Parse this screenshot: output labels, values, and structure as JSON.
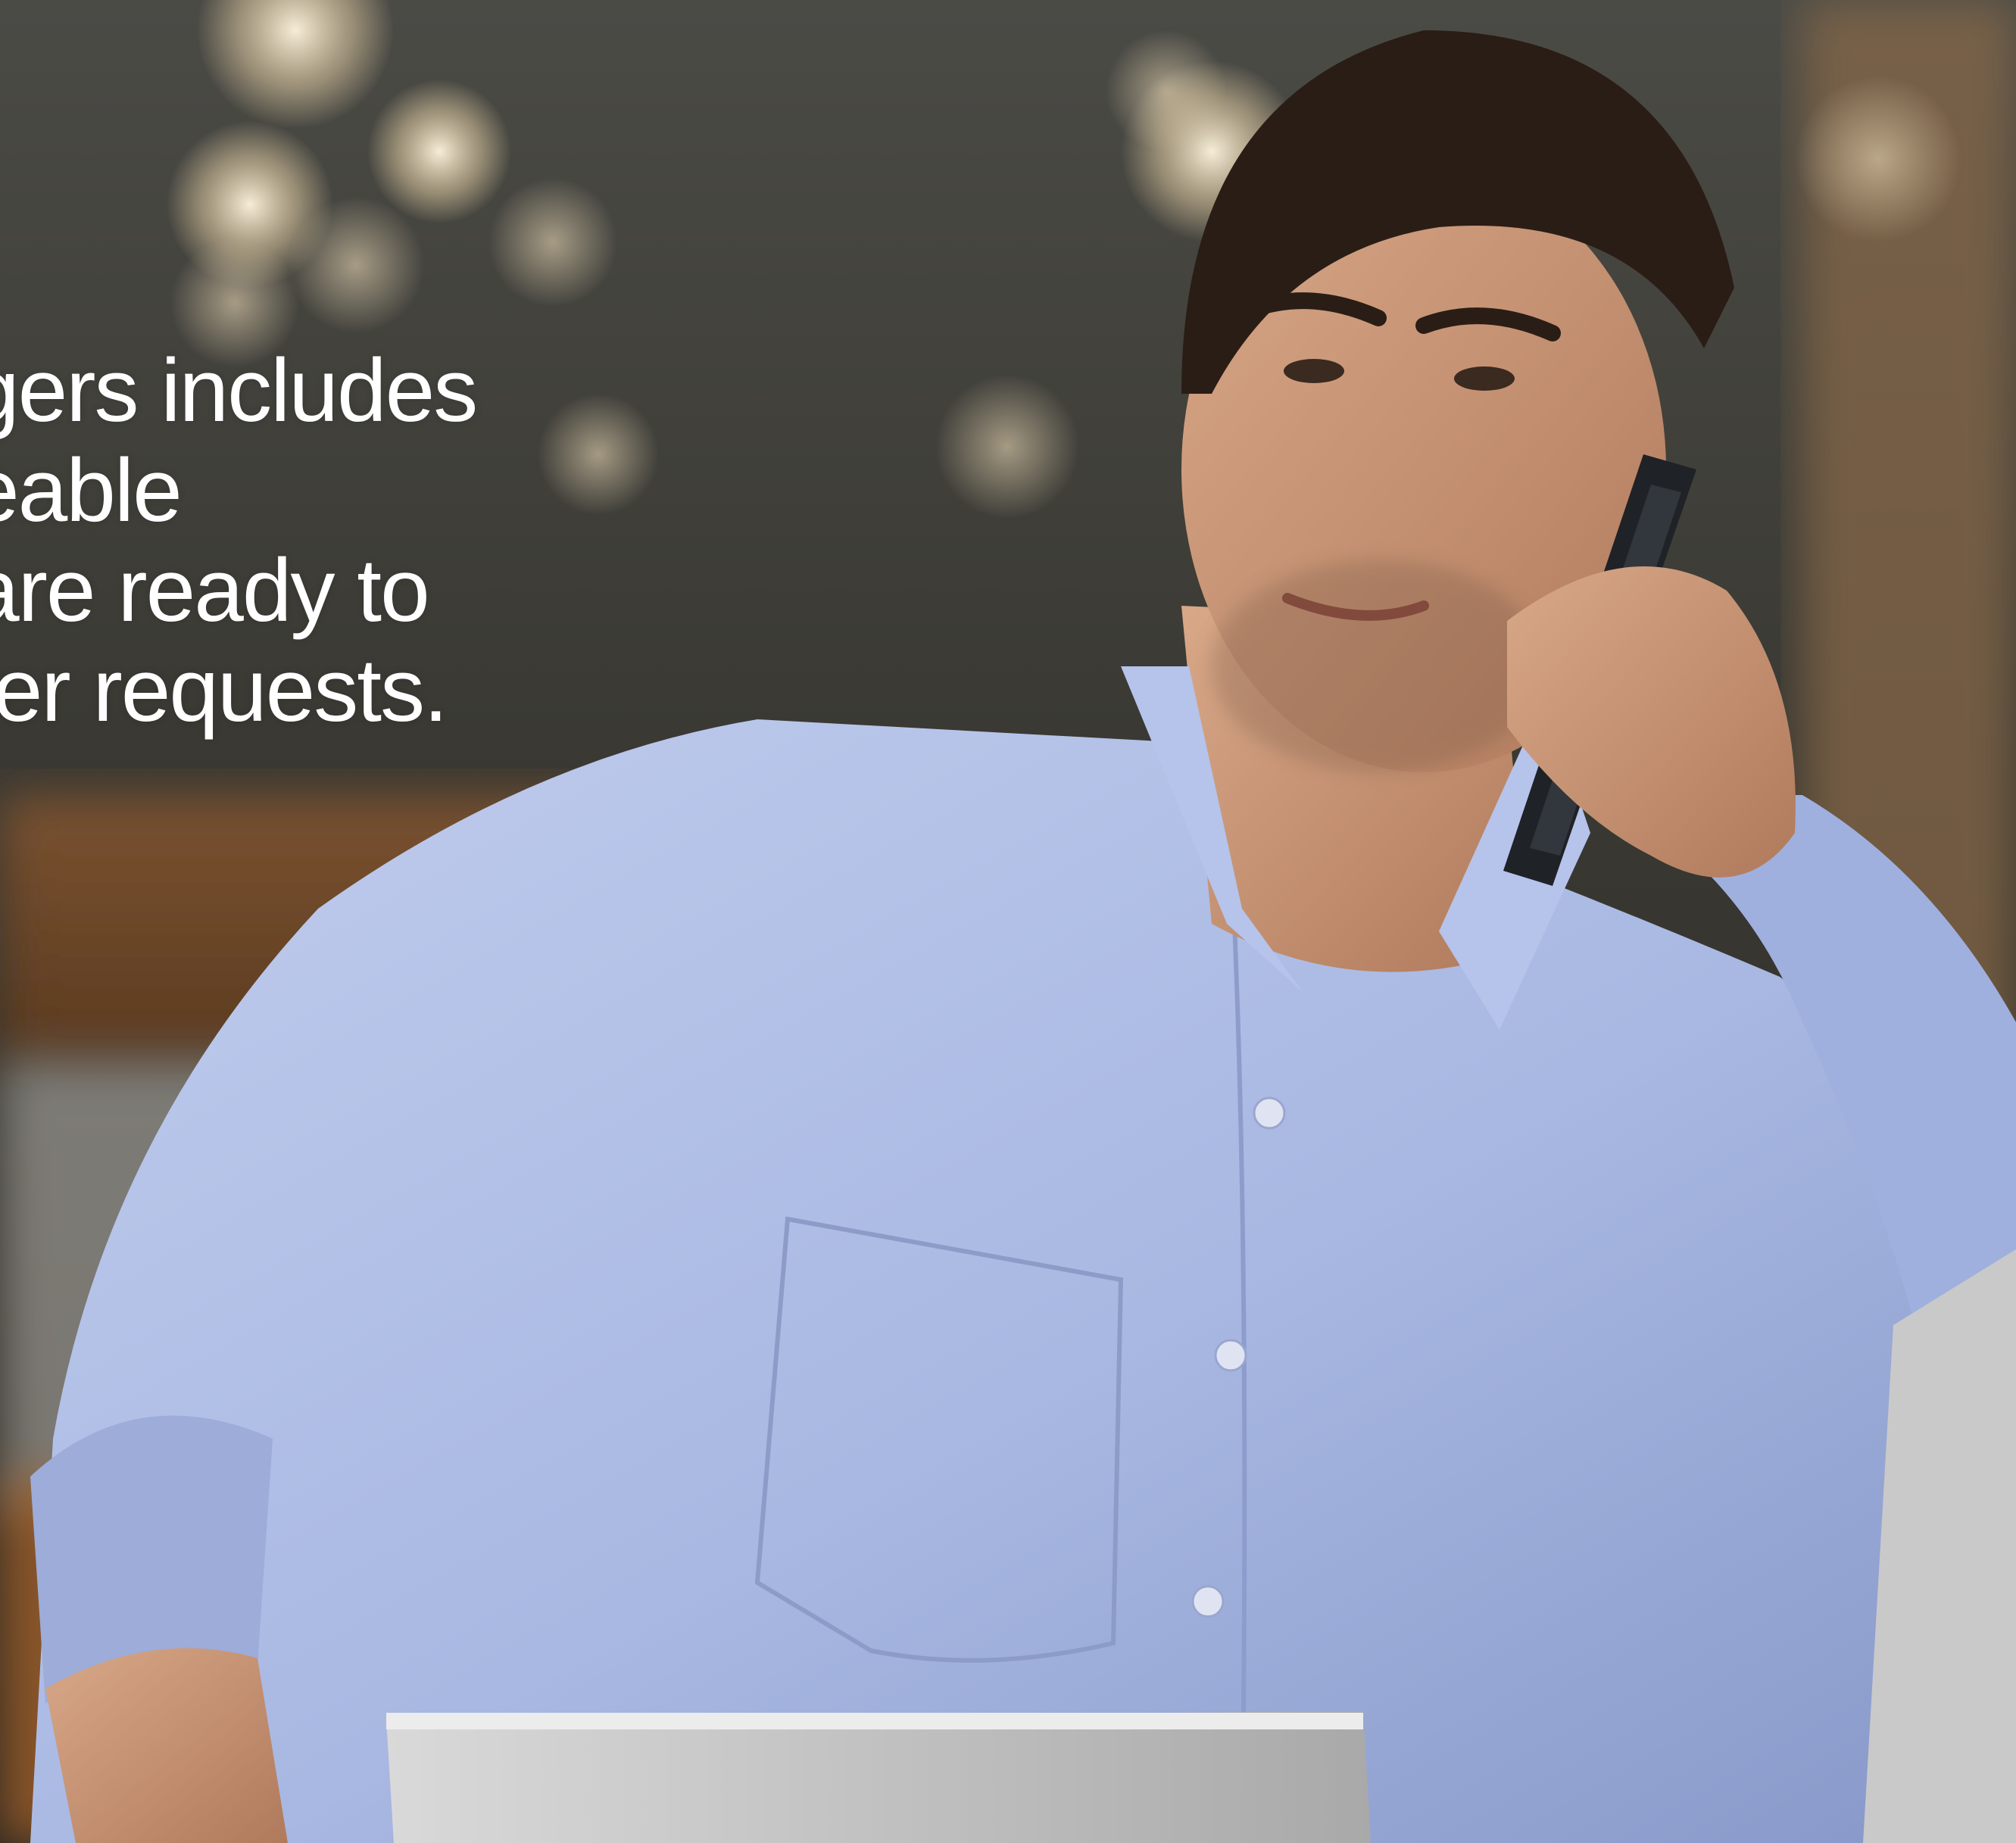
{
  "hero": {
    "lines": [
      "gers includes",
      "eable",
      "are ready to",
      "ter requests."
    ]
  },
  "colors": {
    "text": "#ffffff",
    "shirt": "#a9b9e3",
    "background": "#3a352c"
  }
}
